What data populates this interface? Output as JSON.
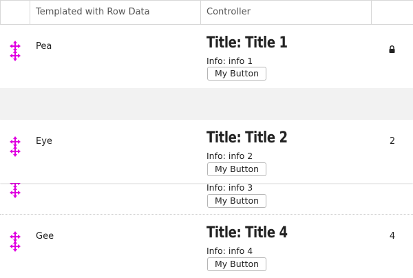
{
  "columns": {
    "drag": "",
    "template": "Templated with Row Data",
    "controller": "Controller",
    "number": ""
  },
  "rows": [
    {
      "name": "Pea",
      "title": "Title: Title 1",
      "info": "Info: info 1",
      "button": "My Button",
      "number": "",
      "locked": true
    },
    {
      "name": "Eye",
      "title": "Title: Title 2",
      "info": "Info: info 2",
      "button": "My Button",
      "number": "2",
      "locked": false
    },
    {
      "name": "",
      "title": "",
      "info": "Info: info 3",
      "button": "My Button",
      "number": "",
      "locked": false
    },
    {
      "name": "Gee",
      "title": "Title: Title 4",
      "info": "Info: info 4",
      "button": "My Button",
      "number": "4",
      "locked": false
    }
  ],
  "colors": {
    "drag_handle": "#e000e0",
    "border": "#d7d7d7",
    "gap_background": "#f2f2f2"
  },
  "icons": {
    "drag": "move-cross-icon",
    "lock": "lock-icon"
  }
}
